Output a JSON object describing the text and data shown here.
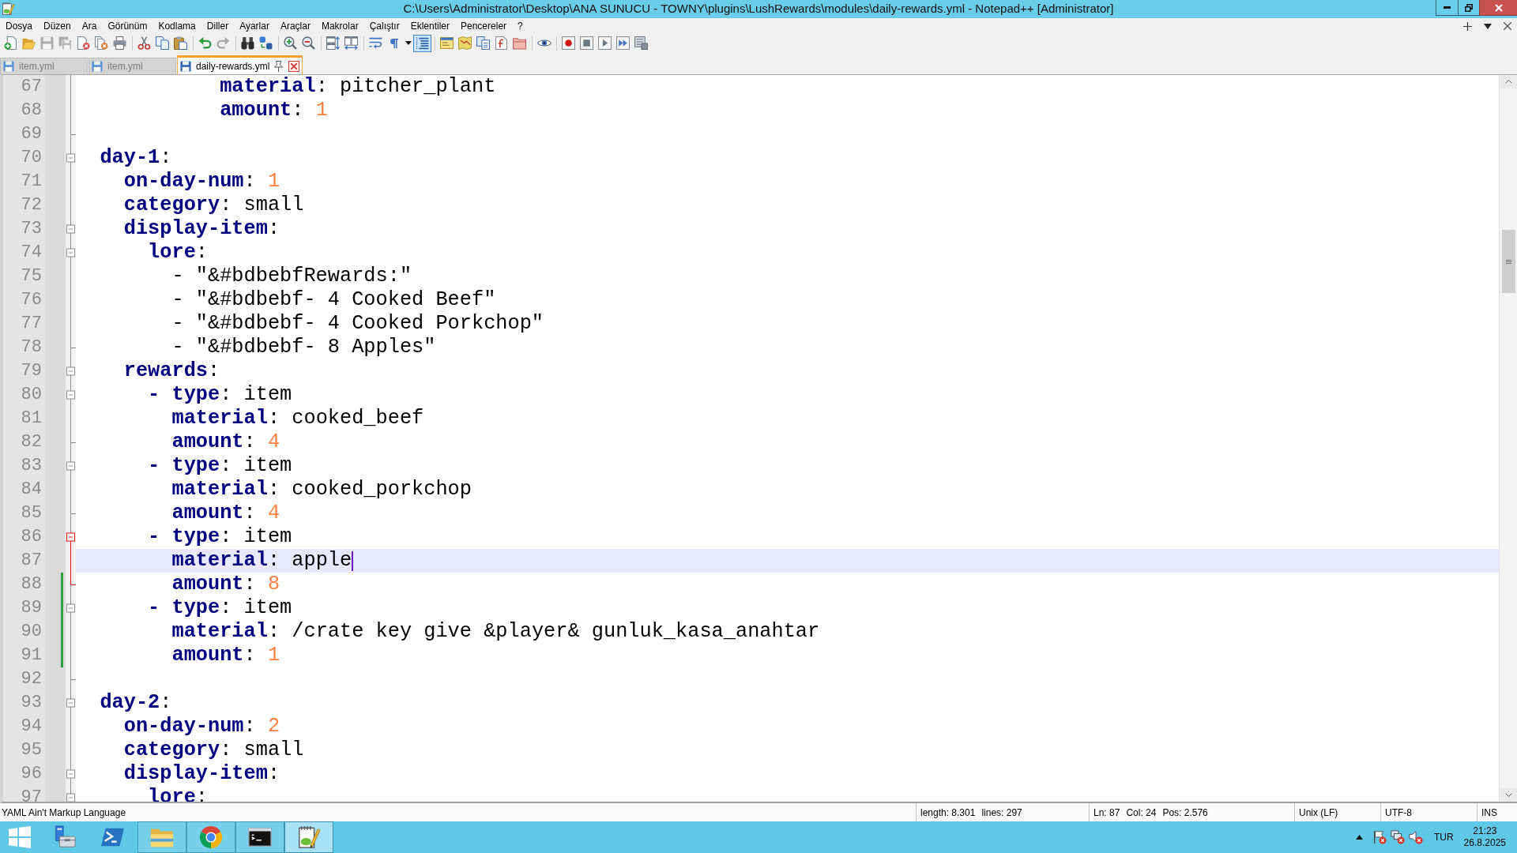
{
  "window": {
    "title": "C:\\Users\\Administrator\\Desktop\\ANA SUNUCU - TOWNY\\plugins\\LushRewards\\modules\\daily-rewards.yml - Notepad++ [Administrator]"
  },
  "menu": [
    "Dosya",
    "Düzen",
    "Ara",
    "Görünüm",
    "Kodlama",
    "Diller",
    "Ayarlar",
    "Araçlar",
    "Makrolar",
    "Çalıştır",
    "Eklentiler",
    "Pencereler",
    "?"
  ],
  "toolbar": {
    "groups": [
      [
        {
          "kind": "new",
          "disabled": false,
          "pressed": false
        },
        {
          "kind": "open",
          "disabled": false,
          "pressed": false
        },
        {
          "kind": "save",
          "disabled": true,
          "pressed": false
        },
        {
          "kind": "saveall",
          "disabled": true,
          "pressed": false
        },
        {
          "kind": "close",
          "disabled": false,
          "pressed": false
        },
        {
          "kind": "closeall",
          "disabled": false,
          "pressed": false
        },
        {
          "kind": "print",
          "disabled": false,
          "pressed": false
        }
      ],
      [
        {
          "kind": "cut",
          "disabled": false,
          "pressed": false
        },
        {
          "kind": "copy",
          "disabled": false,
          "pressed": false
        },
        {
          "kind": "paste",
          "disabled": false,
          "pressed": false
        }
      ],
      [
        {
          "kind": "undo",
          "disabled": false,
          "pressed": false
        },
        {
          "kind": "redo",
          "disabled": true,
          "pressed": false
        }
      ],
      [
        {
          "kind": "find",
          "disabled": false,
          "pressed": false
        },
        {
          "kind": "replace",
          "disabled": false,
          "pressed": false
        }
      ],
      [
        {
          "kind": "zoomin",
          "disabled": false,
          "pressed": false
        },
        {
          "kind": "zoomout",
          "disabled": false,
          "pressed": false
        }
      ],
      [
        {
          "kind": "syncv",
          "disabled": false,
          "pressed": false
        },
        {
          "kind": "synch",
          "disabled": false,
          "pressed": false
        }
      ],
      [
        {
          "kind": "wrap",
          "disabled": false,
          "pressed": false
        },
        {
          "kind": "allchars",
          "disabled": false,
          "pressed": false
        },
        {
          "kind": "dropdown",
          "disabled": false,
          "pressed": false
        },
        {
          "kind": "guides",
          "disabled": false,
          "pressed": true
        }
      ],
      [
        {
          "kind": "udl",
          "disabled": false,
          "pressed": false
        },
        {
          "kind": "docmap",
          "disabled": false,
          "pressed": false
        },
        {
          "kind": "doclist",
          "disabled": false,
          "pressed": false
        },
        {
          "kind": "funclist",
          "disabled": false,
          "pressed": false
        },
        {
          "kind": "workspace",
          "disabled": false,
          "pressed": false
        }
      ],
      [
        {
          "kind": "monitor",
          "disabled": false,
          "pressed": false
        }
      ],
      [
        {
          "kind": "record",
          "disabled": false,
          "pressed": false
        },
        {
          "kind": "stop",
          "disabled": false,
          "pressed": false
        },
        {
          "kind": "play",
          "disabled": false,
          "pressed": false
        },
        {
          "kind": "playall",
          "disabled": false,
          "pressed": false
        },
        {
          "kind": "savemacro",
          "disabled": false,
          "pressed": false
        }
      ]
    ]
  },
  "tabs": [
    {
      "label": "item.yml",
      "selected": false
    },
    {
      "label": "item.yml",
      "selected": false
    },
    {
      "label": "daily-rewards.yml",
      "selected": true
    }
  ],
  "editor": {
    "lines": [
      {
        "num": "67",
        "tokens": [
          {
            "kind": "key",
            "text": "            material"
          },
          {
            "kind": "text",
            "text": ": pitcher_plant"
          }
        ],
        "fold": {
          "kind": "body",
          "active": false
        },
        "changed": false,
        "current": false
      },
      {
        "num": "68",
        "tokens": [
          {
            "kind": "key",
            "text": "            amount"
          },
          {
            "kind": "text",
            "text": ": "
          },
          {
            "kind": "number",
            "text": "1"
          }
        ],
        "fold": {
          "kind": "body",
          "active": false
        },
        "changed": false,
        "current": false
      },
      {
        "num": "69",
        "fold": {
          "kind": "end",
          "active": false
        },
        "changed": false,
        "current": false
      },
      {
        "num": "70",
        "tokens": [
          {
            "kind": "key",
            "text": "  day-1"
          },
          {
            "kind": "text",
            "text": ":"
          }
        ],
        "fold": {
          "kind": "start",
          "active": false
        },
        "changed": false,
        "current": false
      },
      {
        "num": "71",
        "tokens": [
          {
            "kind": "key",
            "text": "    on-day-num"
          },
          {
            "kind": "text",
            "text": ": "
          },
          {
            "kind": "number",
            "text": "1"
          }
        ],
        "fold": {
          "kind": "body",
          "active": false
        },
        "changed": false,
        "current": false
      },
      {
        "num": "72",
        "tokens": [
          {
            "kind": "key",
            "text": "    category"
          },
          {
            "kind": "text",
            "text": ": small"
          }
        ],
        "fold": {
          "kind": "body",
          "active": false
        },
        "changed": false,
        "current": false
      },
      {
        "num": "73",
        "tokens": [
          {
            "kind": "key",
            "text": "    display-item"
          },
          {
            "kind": "text",
            "text": ":"
          }
        ],
        "fold": {
          "kind": "start",
          "active": false
        },
        "changed": false,
        "current": false
      },
      {
        "num": "74",
        "tokens": [
          {
            "kind": "key",
            "text": "      lore"
          },
          {
            "kind": "text",
            "text": ":"
          }
        ],
        "fold": {
          "kind": "start",
          "active": false
        },
        "changed": false,
        "current": false
      },
      {
        "num": "75",
        "tokens": [
          {
            "kind": "text",
            "text": "        - \"&#bdbebfRewards:\""
          }
        ],
        "fold": {
          "kind": "body",
          "active": false
        },
        "changed": false,
        "current": false
      },
      {
        "num": "76",
        "tokens": [
          {
            "kind": "text",
            "text": "        - \"&#bdbebf- 4 Cooked Beef\""
          }
        ],
        "fold": {
          "kind": "body",
          "active": false
        },
        "changed": false,
        "current": false
      },
      {
        "num": "77",
        "tokens": [
          {
            "kind": "text",
            "text": "        - \"&#bdbebf- 4 Cooked Porkchop\""
          }
        ],
        "fold": {
          "kind": "body",
          "active": false
        },
        "changed": false,
        "current": false
      },
      {
        "num": "78",
        "tokens": [
          {
            "kind": "text",
            "text": "        - \"&#bdbebf- 8 Apples\""
          }
        ],
        "fold": {
          "kind": "end",
          "active": false
        },
        "changed": false,
        "current": false
      },
      {
        "num": "79",
        "tokens": [
          {
            "kind": "key",
            "text": "    rewards"
          },
          {
            "kind": "text",
            "text": ":"
          }
        ],
        "fold": {
          "kind": "start",
          "active": false
        },
        "changed": false,
        "current": false
      },
      {
        "num": "80",
        "tokens": [
          {
            "kind": "key",
            "text": "      - type"
          },
          {
            "kind": "text",
            "text": ": item"
          }
        ],
        "fold": {
          "kind": "start",
          "active": false
        },
        "changed": false,
        "current": false
      },
      {
        "num": "81",
        "tokens": [
          {
            "kind": "key",
            "text": "        material"
          },
          {
            "kind": "text",
            "text": ": cooked_beef"
          }
        ],
        "fold": {
          "kind": "body",
          "active": false
        },
        "changed": false,
        "current": false
      },
      {
        "num": "82",
        "tokens": [
          {
            "kind": "key",
            "text": "        amount"
          },
          {
            "kind": "text",
            "text": ": "
          },
          {
            "kind": "number",
            "text": "4"
          }
        ],
        "fold": {
          "kind": "end",
          "active": false
        },
        "changed": false,
        "current": false
      },
      {
        "num": "83",
        "tokens": [
          {
            "kind": "key",
            "text": "      - type"
          },
          {
            "kind": "text",
            "text": ": item"
          }
        ],
        "fold": {
          "kind": "start",
          "active": false
        },
        "changed": false,
        "current": false
      },
      {
        "num": "84",
        "tokens": [
          {
            "kind": "key",
            "text": "        material"
          },
          {
            "kind": "text",
            "text": ": cooked_porkchop"
          }
        ],
        "fold": {
          "kind": "body",
          "active": false
        },
        "changed": false,
        "current": false
      },
      {
        "num": "85",
        "tokens": [
          {
            "kind": "key",
            "text": "        amount"
          },
          {
            "kind": "text",
            "text": ": "
          },
          {
            "kind": "number",
            "text": "4"
          }
        ],
        "fold": {
          "kind": "end",
          "active": false
        },
        "changed": false,
        "current": false
      },
      {
        "num": "86",
        "tokens": [
          {
            "kind": "key",
            "text": "      - type"
          },
          {
            "kind": "text",
            "text": ": item"
          }
        ],
        "fold": {
          "kind": "start",
          "active": true
        },
        "changed": false,
        "current": false
      },
      {
        "num": "87",
        "tokens": [
          {
            "kind": "key",
            "text": "        material"
          },
          {
            "kind": "text",
            "text": ": apple"
          }
        ],
        "fold": {
          "kind": "body",
          "active": true
        },
        "changed": false,
        "current": true
      },
      {
        "num": "88",
        "tokens": [
          {
            "kind": "key",
            "text": "        amount"
          },
          {
            "kind": "text",
            "text": ": "
          },
          {
            "kind": "number",
            "text": "8"
          }
        ],
        "fold": {
          "kind": "end",
          "active": true
        },
        "changed": true,
        "current": false
      },
      {
        "num": "89",
        "tokens": [
          {
            "kind": "key",
            "text": "      - type"
          },
          {
            "kind": "text",
            "text": ": item"
          }
        ],
        "fold": {
          "kind": "start",
          "active": false
        },
        "changed": true,
        "current": false
      },
      {
        "num": "90",
        "tokens": [
          {
            "kind": "key",
            "text": "        material"
          },
          {
            "kind": "text",
            "text": ": /crate key give &player& gunluk_kasa_anahtar"
          }
        ],
        "fold": {
          "kind": "body",
          "active": false
        },
        "changed": true,
        "current": false
      },
      {
        "num": "91",
        "tokens": [
          {
            "kind": "key",
            "text": "        amount"
          },
          {
            "kind": "text",
            "text": ": "
          },
          {
            "kind": "number",
            "text": "1"
          }
        ],
        "fold": {
          "kind": "body",
          "active": false
        },
        "changed": true,
        "current": false
      },
      {
        "num": "92",
        "fold": {
          "kind": "end",
          "active": false
        },
        "changed": false,
        "current": false
      },
      {
        "num": "93",
        "tokens": [
          {
            "kind": "key",
            "text": "  day-2"
          },
          {
            "kind": "text",
            "text": ":"
          }
        ],
        "fold": {
          "kind": "start",
          "active": false
        },
        "changed": false,
        "current": false
      },
      {
        "num": "94",
        "tokens": [
          {
            "kind": "key",
            "text": "    on-day-num"
          },
          {
            "kind": "text",
            "text": ": "
          },
          {
            "kind": "number",
            "text": "2"
          }
        ],
        "fold": {
          "kind": "body",
          "active": false
        },
        "changed": false,
        "current": false
      },
      {
        "num": "95",
        "tokens": [
          {
            "kind": "key",
            "text": "    category"
          },
          {
            "kind": "text",
            "text": ": small"
          }
        ],
        "fold": {
          "kind": "body",
          "active": false
        },
        "changed": false,
        "current": false
      },
      {
        "num": "96",
        "tokens": [
          {
            "kind": "key",
            "text": "    display-item"
          },
          {
            "kind": "text",
            "text": ":"
          }
        ],
        "fold": {
          "kind": "start",
          "active": false
        },
        "changed": false,
        "current": false
      },
      {
        "num": "97",
        "tokens": [
          {
            "kind": "key",
            "text": "      lore"
          },
          {
            "kind": "text",
            "text": ":"
          }
        ],
        "fold": {
          "kind": "start",
          "active": false
        },
        "changed": false,
        "current": false
      }
    ]
  },
  "status_bar": {
    "language": "YAML Ain't Markup Language",
    "length": "length: 8.301",
    "lines": "lines: 297",
    "line": "Ln: 87",
    "column": "Col: 24",
    "position": "Pos: 2.576",
    "eol": "Unix (LF)",
    "encoding": "UTF-8",
    "mode": "INS"
  },
  "taskbar": {
    "apps": [
      {
        "kind": "servermanager",
        "running": false,
        "selected": false
      },
      {
        "kind": "powershell",
        "running": false,
        "selected": false
      },
      {
        "kind": "explorer",
        "running": true,
        "selected": false
      },
      {
        "kind": "chrome",
        "running": true,
        "selected": false
      },
      {
        "kind": "cmd",
        "running": true,
        "selected": false
      },
      {
        "kind": "notepad",
        "running": true,
        "selected": true
      }
    ],
    "tray": {
      "language": "TUR",
      "time": "21:23",
      "date": "26.8.2025"
    }
  }
}
